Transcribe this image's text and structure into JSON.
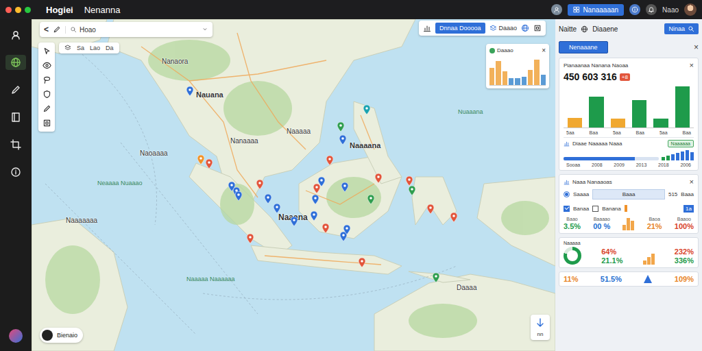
{
  "window": {
    "title": "Hogiei",
    "subtitle": "Nenanna",
    "controls": [
      {
        "color": "#ff5f57"
      },
      {
        "color": "#febc2e"
      },
      {
        "color": "#28c840"
      }
    ]
  },
  "topbar": {
    "button": "Nanaaaaan",
    "user_label": "Naao"
  },
  "sidebar": {
    "items": [
      {
        "kind": "user",
        "selected": false
      },
      {
        "kind": "globe",
        "selected": true
      },
      {
        "kind": "pen",
        "selected": false
      },
      {
        "kind": "book",
        "selected": false
      },
      {
        "kind": "crop",
        "selected": false
      },
      {
        "kind": "info",
        "selected": false
      }
    ]
  },
  "map": {
    "search": {
      "back": "<",
      "value": "Hoao"
    },
    "layer_tabs": [
      "Sa",
      "Lao",
      "Da"
    ],
    "tools": [
      {
        "kind": "select"
      },
      {
        "kind": "eye"
      },
      {
        "kind": "lasso"
      },
      {
        "kind": "shield"
      },
      {
        "kind": "pen"
      },
      {
        "kind": "frame"
      }
    ],
    "top_controls": {
      "button": "Dnnaa Dooooa",
      "label": "Daaao"
    },
    "mini_chart": {
      "title": "Daaao",
      "close": "×",
      "bars": [
        {
          "value": 10,
          "color": "#f2b15a"
        },
        {
          "value": 14,
          "color": "#f2b15a"
        },
        {
          "value": 8,
          "color": "#f2b15a"
        },
        {
          "value": 4,
          "color": "#5b9bd5"
        },
        {
          "value": 4,
          "color": "#5b9bd5"
        },
        {
          "value": 5,
          "color": "#5b9bd5"
        },
        {
          "value": 9,
          "color": "#f2b15a"
        },
        {
          "value": 15,
          "color": "#f2b15a"
        },
        {
          "value": 6,
          "color": "#5b9bd5"
        }
      ]
    },
    "labels": [
      {
        "text": "Nanaora",
        "kind": "place"
      },
      {
        "text": "Nauana",
        "kind": "pin"
      },
      {
        "text": "Naaaaa",
        "kind": "place"
      },
      {
        "text": "Nanaaaa",
        "kind": "place"
      },
      {
        "text": "Naoaaaa",
        "kind": "place"
      },
      {
        "text": "Neaaaa Nuaaao",
        "kind": "ocean"
      },
      {
        "text": "Nuaaana",
        "kind": "ocean"
      },
      {
        "text": "Naaaana",
        "kind": "pin"
      },
      {
        "text": "Naaana",
        "kind": "major"
      },
      {
        "text": "Naaaaaaa",
        "kind": "place"
      },
      {
        "text": "Naaaaa Naaaaaa",
        "kind": "ocean"
      },
      {
        "text": "Daaaa",
        "kind": "place"
      }
    ],
    "pins": [
      {
        "color": "#2f6fd8"
      },
      {
        "color": "#e2553b"
      },
      {
        "color": "#2f6fd8"
      },
      {
        "color": "#2f6fd8"
      },
      {
        "color": "#2f6fd8"
      },
      {
        "color": "#e2553b"
      },
      {
        "color": "#2f6fd8"
      },
      {
        "color": "#2f6fd8"
      },
      {
        "color": "#2f6fd8"
      },
      {
        "color": "#2f6fd8"
      },
      {
        "color": "#2f6fd8"
      },
      {
        "color": "#e2553b"
      },
      {
        "color": "#2f6fd8"
      },
      {
        "color": "#e2553b"
      },
      {
        "color": "#2f6fd8"
      },
      {
        "color": "#2f9e4f"
      },
      {
        "color": "#1aa3b0"
      },
      {
        "color": "#2f6fd8"
      },
      {
        "color": "#2f9e4f"
      },
      {
        "color": "#e2553b"
      },
      {
        "color": "#e2553b"
      },
      {
        "color": "#2f9e4f"
      },
      {
        "color": "#e2553b"
      },
      {
        "color": "#e2553b"
      },
      {
        "color": "#2f6fd8"
      },
      {
        "color": "#2f6fd8"
      },
      {
        "color": "#e2553b"
      },
      {
        "color": "#e2553b"
      },
      {
        "color": "#e2553b"
      },
      {
        "color": "#2f9e4f"
      },
      {
        "color": "#f0922a"
      }
    ],
    "scale": {
      "label": "Bienaio"
    },
    "compass": {
      "label": "nn"
    }
  },
  "panel": {
    "header": {
      "title": "Naitte",
      "subtitle": "Diaaene",
      "button": "Ninaa"
    },
    "filter": {
      "label": "Nenaaane",
      "close": "×"
    },
    "summary": {
      "title": "Pianaanaa Nanana Naoaa",
      "close": "×",
      "total": "450 603 316",
      "badge": "+8",
      "bars": [
        {
          "value": 14,
          "color": "#f0a830"
        },
        {
          "value": 45,
          "color": "#1e9b4b"
        },
        {
          "value": 13,
          "color": "#f0a830"
        },
        {
          "value": 40,
          "color": "#1e9b4b"
        },
        {
          "value": 13,
          "color": "#1e9b4b"
        },
        {
          "value": 60,
          "color": "#1e9b4b"
        }
      ],
      "ticks": [
        "5aa",
        "Baa",
        "5aa",
        "Baa",
        "5aa",
        "Baa"
      ]
    },
    "trend": {
      "label": "Diaae Naaaaa Naaa",
      "badge": "Naaaaaa",
      "level": 0.75,
      "bars": [
        {
          "value": 5,
          "color": "#1e9b4b"
        },
        {
          "value": 7,
          "color": "#1e9b4b"
        },
        {
          "value": 9,
          "color": "#2f6fd8"
        },
        {
          "value": 11,
          "color": "#2f6fd8"
        },
        {
          "value": 13,
          "color": "#2f6fd8"
        },
        {
          "value": 15,
          "color": "#2f6fd8"
        },
        {
          "value": 12,
          "color": "#2f6fd8"
        }
      ],
      "ticks": [
        "Sooaa",
        "2008",
        "2009",
        "2013",
        "2018",
        "2006"
      ]
    },
    "details": {
      "title": "Naaa Nanaaoas",
      "close": "×",
      "option": {
        "label": "Saaaa",
        "selected": true
      },
      "field": "Baaa",
      "count": "515",
      "unit": "Baaa",
      "checks": [
        {
          "label": "Banaa",
          "checked": true
        },
        {
          "label": "Banana",
          "checked": false
        }
      ],
      "tag": "1a"
    },
    "metrics": [
      {
        "kind": "labels",
        "items": [
          {
            "label": "Baao",
            "value": "3.5%",
            "color": "#1e9b4b"
          },
          {
            "label": "Baaaao",
            "value": "00 %",
            "color": "#1f6fd1"
          },
          {
            "label": "Baoa",
            "value": "21%",
            "color": "#e8862a"
          },
          {
            "label": "Baaoo",
            "value": "100%",
            "color": "#d9442b"
          }
        ],
        "bars": [
          8,
          18,
          14
        ]
      },
      {
        "kind": "donut",
        "title": "Naaaaa",
        "level": 0.8,
        "items": [
          {
            "value": "64%",
            "color": "#d9442b"
          },
          {
            "value": "21.1%",
            "color": "#1e9b4b"
          },
          {
            "value": "232%",
            "color": "#d9442b"
          },
          {
            "value": "336%",
            "color": "#1e9b4b"
          }
        ],
        "bars": [
          6,
          11,
          16
        ]
      },
      {
        "kind": "plain",
        "items": [
          {
            "value": "11%",
            "color": "#e8862a"
          },
          {
            "value": "51.5%",
            "color": "#1f6fd1"
          },
          {
            "value": "109%",
            "color": "#e8862a"
          }
        ]
      }
    ]
  }
}
